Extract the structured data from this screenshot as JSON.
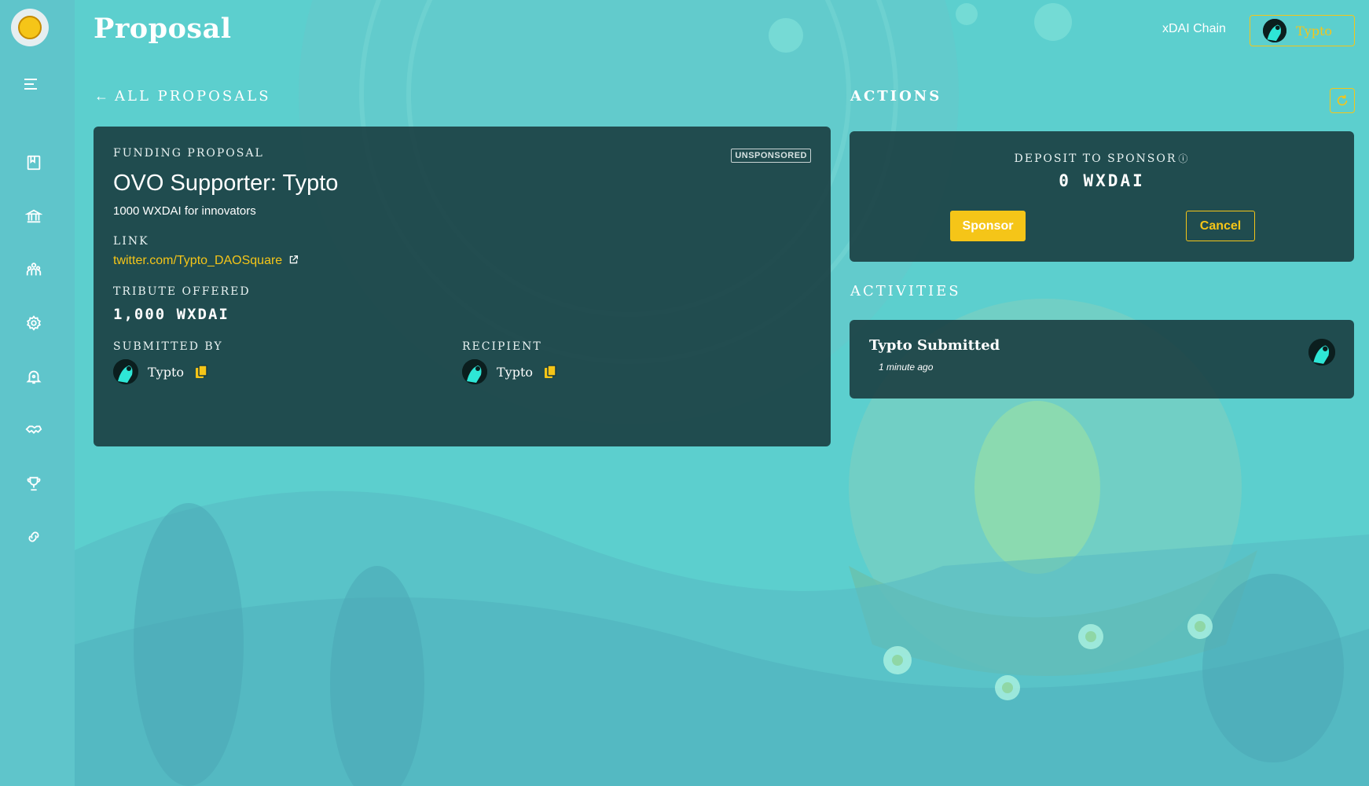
{
  "header": {
    "title": "Proposal",
    "chain": "xDAI Chain",
    "user_label": "Typto"
  },
  "nav": {
    "back_label": "ALL PROPOSALS",
    "icons": [
      "menu-icon",
      "book-icon",
      "bank-icon",
      "members-icon",
      "settings-icon",
      "bell-icon",
      "handshake-icon",
      "trophy-icon",
      "link-icon"
    ]
  },
  "proposal": {
    "type_label": "FUNDING PROPOSAL",
    "status_badge": "UNSPONSORED",
    "title": "OVO Supporter: Typto",
    "description": "1000 WXDAI for innovators",
    "link_label": "LINK",
    "link_text": "twitter.com/Typto_DAOSquare",
    "tribute_label": "TRIBUTE OFFERED",
    "tribute_value": "1,000 WXDAI",
    "submitted_by_label": "SUBMITTED BY",
    "submitted_by_name": "Typto",
    "recipient_label": "RECIPIENT",
    "recipient_name": "Typto"
  },
  "actions": {
    "title": "ACTIONS",
    "deposit_label": "DEPOSIT TO SPONSOR",
    "deposit_value": "0 WXDAI",
    "sponsor_label": "Sponsor",
    "cancel_label": "Cancel"
  },
  "activities": {
    "title": "ACTIVITIES",
    "items": [
      {
        "title": "Typto Submitted",
        "time": "1 minute ago"
      }
    ]
  },
  "colors": {
    "accent": "#f5c518",
    "card_bg": "#183a3e",
    "page_bg": "#5fcfcf"
  }
}
